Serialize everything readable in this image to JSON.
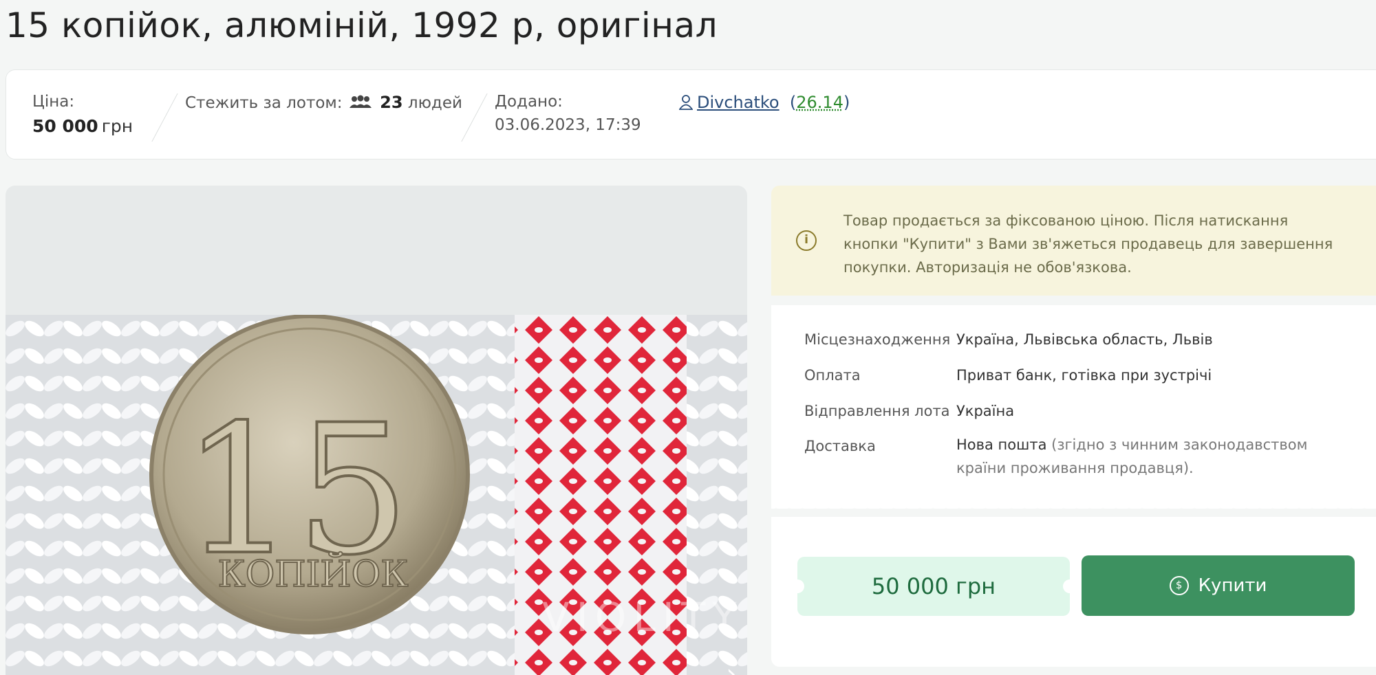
{
  "title": "15 копійок, алюміній, 1992 р, оригінал",
  "info": {
    "price_label": "Ціна:",
    "price_value": "50 000",
    "price_currency": "грн",
    "watch_label": "Стежить за лотом:",
    "watch_count": "23",
    "watch_unit": "людей",
    "added_label": "Додано:",
    "added_value": "03.06.2023, 17:39",
    "seller_name": "Divchatko",
    "seller_rating": "26.14"
  },
  "photo": {
    "coin_number": "15",
    "coin_text": "КОПІЙОК",
    "watermark": "VIOLITY"
  },
  "notice": {
    "text": "Товар продається за фіксованою ціною. Після натискання кнопки \"Купити\" з Вами зв'яжеться продавець для завершення покупки. Авторизація не обов'язкова."
  },
  "details": [
    {
      "key": "Місцезнаходження",
      "value": "Україна, Львівська область, Львів",
      "note": ""
    },
    {
      "key": "Оплата",
      "value": "Приват банк, готівка при зустрічі",
      "note": ""
    },
    {
      "key": "Відправлення лота",
      "value": "Україна",
      "note": ""
    },
    {
      "key": "Доставка",
      "value": "Нова пошта",
      "note": " (згідно з чинним законодавством країни проживання продавця)."
    }
  ],
  "buy": {
    "price": "50 000 грн",
    "button_label": "Купити"
  },
  "colors": {
    "accent": "#3d9160",
    "notice_bg": "#f7f4dd",
    "price_bg": "#dff7ea",
    "link": "#2a4d7a"
  }
}
